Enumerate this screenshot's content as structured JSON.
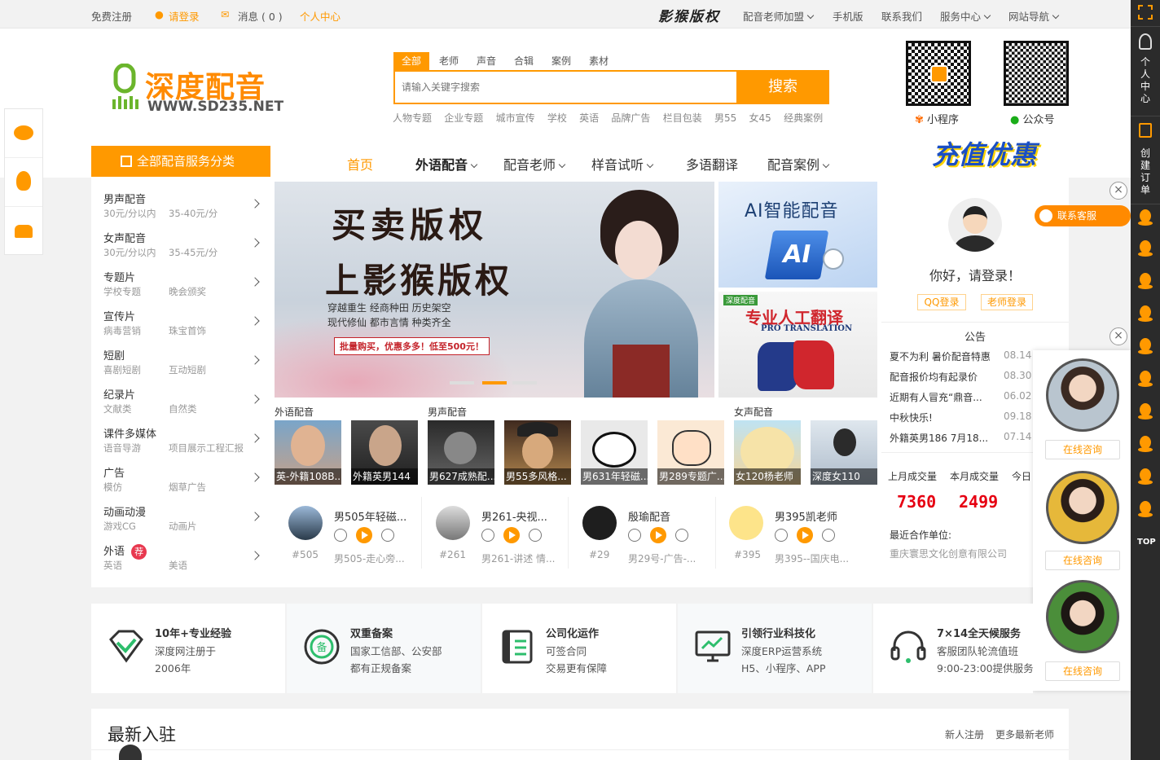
{
  "topbar": {
    "register": "免费注册",
    "login": "请登录",
    "messages": "消息 ( 0 )",
    "user_center": "个人中心",
    "copyright_brand": "影猴版权",
    "join": "配音老师加盟",
    "mobile": "手机版",
    "contact": "联系我们",
    "service": "服务中心",
    "sitenav": "网站导航"
  },
  "logo": {
    "name": "深度配音",
    "url": "WWW.SD235.NET"
  },
  "search": {
    "tabs": [
      "全部",
      "老师",
      "声音",
      "合辑",
      "案例",
      "素材"
    ],
    "placeholder": "请输入关键字搜索",
    "button": "搜索",
    "hot": [
      "人物专题",
      "企业专题",
      "城市宣传",
      "学校",
      "英语",
      "品牌广告",
      "栏目包装",
      "男55",
      "女45",
      "经典案例"
    ]
  },
  "qr": {
    "mini": "小程序",
    "official": "公众号"
  },
  "nav": {
    "all_categories": "全部配音服务分类",
    "items": [
      {
        "label": "首页"
      },
      {
        "label": "外语配音"
      },
      {
        "label": "配音老师"
      },
      {
        "label": "样音试听"
      },
      {
        "label": "多语翻译"
      },
      {
        "label": "配音案例"
      }
    ],
    "promo": "充值优惠"
  },
  "categories": [
    {
      "title": "男声配音",
      "a": "30元/分以内",
      "b": "35-40元/分"
    },
    {
      "title": "女声配音",
      "a": "30元/分以内",
      "b": "35-45元/分"
    },
    {
      "title": "专题片",
      "a": "学校专题",
      "b": "晚会颁奖"
    },
    {
      "title": "宣传片",
      "a": "病毒营销",
      "b": "珠宝首饰"
    },
    {
      "title": "短剧",
      "a": "喜剧短剧",
      "b": "互动短剧"
    },
    {
      "title": "纪录片",
      "a": "文献类",
      "b": "自然类"
    },
    {
      "title": "课件多媒体",
      "a": "语音导游",
      "b": "项目展示工程汇报"
    },
    {
      "title": "广告",
      "a": "模仿",
      "b": "烟草广告"
    },
    {
      "title": "动画动漫",
      "a": "游戏CG",
      "b": "动画片"
    },
    {
      "title": "外语",
      "a": "英语",
      "b": "美语",
      "badge": "荐"
    }
  ],
  "banner": {
    "line1": "买卖版权",
    "line2": "上影猴版权",
    "tags1": "穿越重生  经商种田  历史架空",
    "tags2": "现代修仙  都市言情  种类齐全",
    "offer": "批量购买，优惠多多！低至500元！"
  },
  "side_banners": {
    "ai": "AI智能配音",
    "trans": "专业人工翻译",
    "trans_en": "PRO TRANSLATION",
    "brand": "深度配音"
  },
  "section_labels": {
    "foreign": "外语配音",
    "male": "男声配音",
    "female": "女声配音"
  },
  "thumbs": [
    "英-外籍108B...",
    "外籍英男144",
    "男627成熟配...",
    "男55多风格...",
    "男631年轻磁...",
    "男289专题广...",
    "女120杨老师",
    "深度女110"
  ],
  "players": [
    {
      "name": "男505年轻磁...",
      "id": "#505",
      "desc": "男505-走心旁..."
    },
    {
      "name": "男261-央视...",
      "id": "#261",
      "desc": "男261-讲述 情..."
    },
    {
      "name": "殷瑜配音",
      "id": "#29",
      "desc": "男29号-广告-..."
    },
    {
      "name": "男395凯老师",
      "id": "#395",
      "desc": "男395--国庆电..."
    }
  ],
  "login_box": {
    "greet": "你好，请登录！",
    "qq": "QQ登录",
    "teacher": "老师登录"
  },
  "notice": {
    "title": "公告",
    "items": [
      {
        "text": "夏不为利 暑价配音特惠",
        "date": "08.14"
      },
      {
        "text": "配音报价均有起录价",
        "date": "08.30"
      },
      {
        "text": "近期有人冒充“鼎音...",
        "date": "06.02"
      },
      {
        "text": "中秋快乐!",
        "date": "09.18"
      },
      {
        "text": "外籍英男186 7月18...",
        "date": "07.14"
      }
    ]
  },
  "stats": {
    "last_label": "上月成交量",
    "last": "7360",
    "this_label": "本月成交量",
    "this": "2499",
    "today_label": "今日",
    "partner_label": "最近合作单位:",
    "partner": "重庆寰思文化创意有限公司"
  },
  "features": [
    {
      "h": "10年+专业经验",
      "d1": "深度网注册于",
      "d2": "2006年"
    },
    {
      "h": "双重备案",
      "d1": "国家工信部、公安部",
      "d2": "都有正规备案"
    },
    {
      "h": "公司化运作",
      "d1": "可签合同",
      "d2": "交易更有保障"
    },
    {
      "h": "引领行业科技化",
      "d1": "深度ERP运营系统",
      "d2": "H5、小程序、APP"
    },
    {
      "h": "7×14全天候服务",
      "d1": "客服团队轮流值班",
      "d2": "9:00-23:00提供服务"
    }
  ],
  "newest": {
    "title": "最新入驻",
    "reg": "新人注册",
    "more": "更多最新老师"
  },
  "service": {
    "contact": "联系客服",
    "online": "在线咨询"
  },
  "rbar": {
    "user": "个人中心",
    "order": "创建订单",
    "top": "TOP"
  }
}
